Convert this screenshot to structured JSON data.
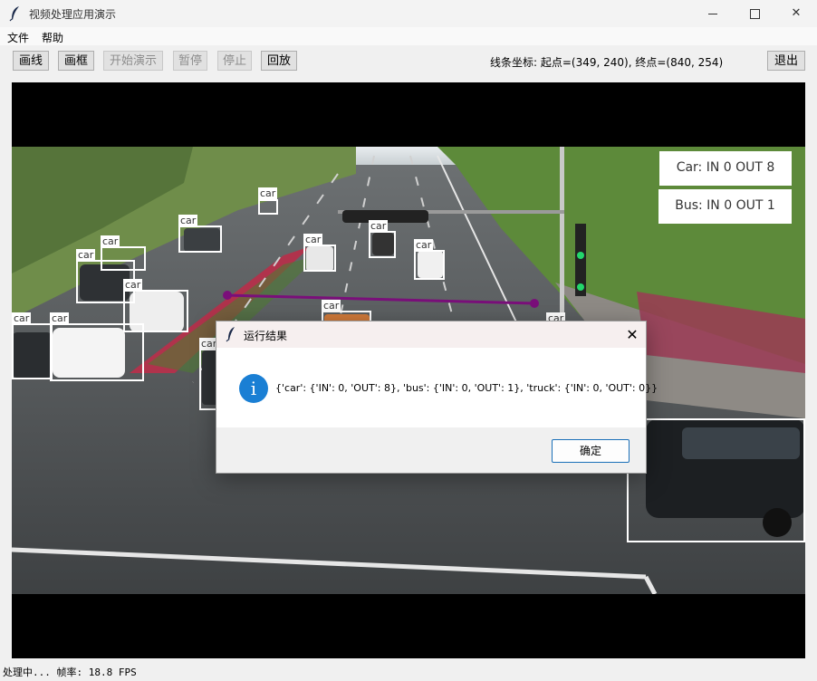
{
  "window": {
    "title": "视频处理应用演示",
    "controls": {
      "minimize": "minimize-icon",
      "maximize": "maximize-icon",
      "close": "✕"
    }
  },
  "menu": {
    "items": [
      "文件",
      "帮助"
    ]
  },
  "toolbar": {
    "buttons": [
      {
        "label": "画线",
        "enabled": true
      },
      {
        "label": "画框",
        "enabled": true
      },
      {
        "label": "开始演示",
        "enabled": false
      },
      {
        "label": "暂停",
        "enabled": false
      },
      {
        "label": "停止",
        "enabled": false
      },
      {
        "label": "回放",
        "enabled": true
      }
    ],
    "line_coords_text": "线条坐标: 起点=(349, 240), 终点=(840, 254)",
    "exit_label": "退出"
  },
  "video": {
    "counters": [
      {
        "text": "Car: IN 0 OUT 8"
      },
      {
        "text": "Bus: IN 0 OUT 1"
      }
    ],
    "detection_label": "car",
    "line_color": "#7a0f7a"
  },
  "status": {
    "text": "处理中... 帧率: 18.8 FPS"
  },
  "dialog": {
    "title": "运行结果",
    "close": "✕",
    "icon": "info-icon",
    "message": "{'car': {'IN': 0, 'OUT': 8}, 'bus': {'IN': 0, 'OUT': 1}, 'truck': {'IN': 0, 'OUT': 0}}",
    "ok_label": "确定"
  }
}
